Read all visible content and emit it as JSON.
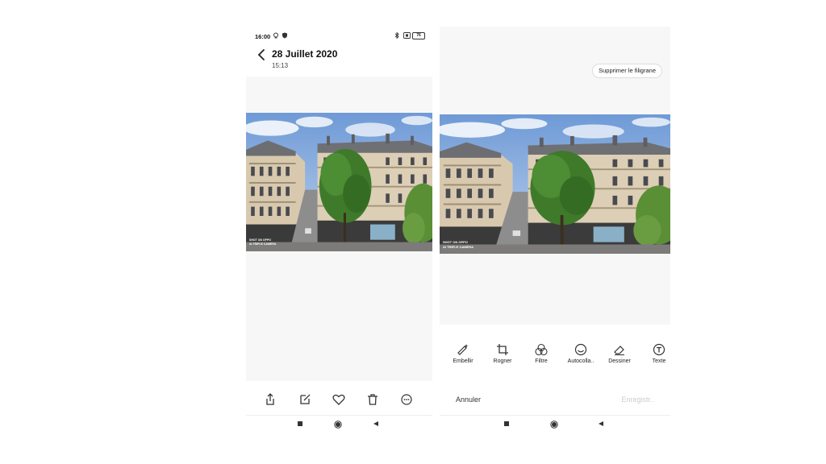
{
  "colors": {
    "accent": "#222222",
    "disabled": "#cccccc",
    "canvas": "#f7f7f7",
    "divider": "#eeeeee"
  },
  "left_screen": {
    "status_bar": {
      "time": "16:00",
      "battery": "76"
    },
    "header": {
      "title": "28 Juillet 2020",
      "subtitle": "15:13"
    },
    "photo": {
      "watermark_line1": "SHOT ON OPPO",
      "watermark_line2": "AI TRIPLE CAMERA"
    },
    "toolbar": {
      "icons": [
        "share-icon",
        "edit-icon",
        "heart-icon",
        "trash-icon",
        "more-icon"
      ]
    }
  },
  "right_screen": {
    "remove_watermark_label": "Supprimer le filigrane",
    "photo": {
      "watermark_line1": "SHOT ON OPPO",
      "watermark_line2": "AI TRIPLE CAMERA"
    },
    "tools": [
      {
        "label": "Embellir",
        "icon": "magic-wand-icon"
      },
      {
        "label": "Rogner",
        "icon": "crop-icon"
      },
      {
        "label": "Filtre",
        "icon": "filter-icon"
      },
      {
        "label": "Autocolla..",
        "icon": "sticker-icon"
      },
      {
        "label": "Dessiner",
        "icon": "draw-icon"
      },
      {
        "label": "Texte",
        "icon": "text-icon"
      }
    ],
    "cancel_label": "Annuler",
    "save_label": "Enregistr.."
  },
  "nav_icons": [
    "recents-square-icon",
    "home-circle-icon",
    "back-triangle-icon"
  ]
}
